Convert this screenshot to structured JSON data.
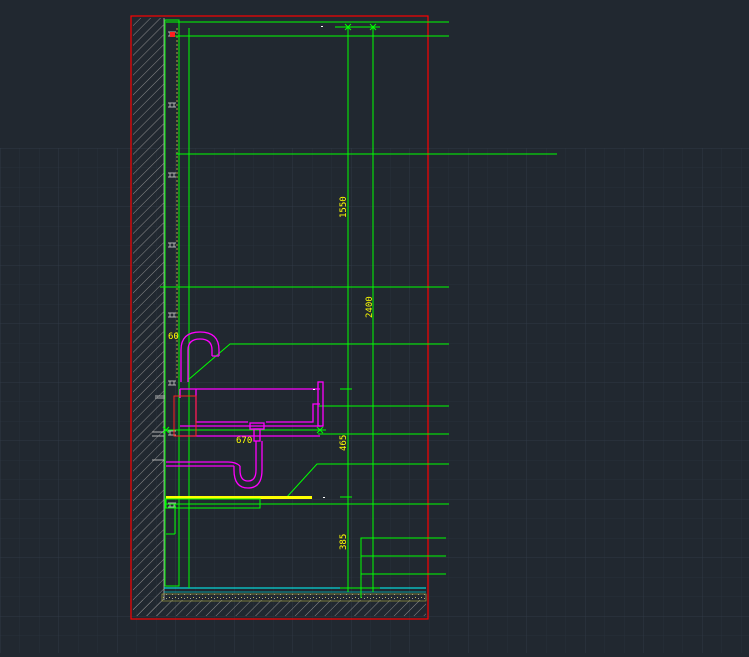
{
  "drawing": {
    "type": "CAD section elevation (sink wall)",
    "colors": {
      "background": "#212830",
      "grid": "#2b3440",
      "dimension": "#00ff00",
      "dimension_text": "#ffff00",
      "fixture": "#ff00ff",
      "border": "#ff0000",
      "wall_hatch": "#8a8a8a"
    },
    "dimensions": {
      "total_height": "2400",
      "upper_height": "1550",
      "sink_height": "465",
      "lower_height": "385",
      "sink_width": "670",
      "tap_offset": "60"
    }
  }
}
